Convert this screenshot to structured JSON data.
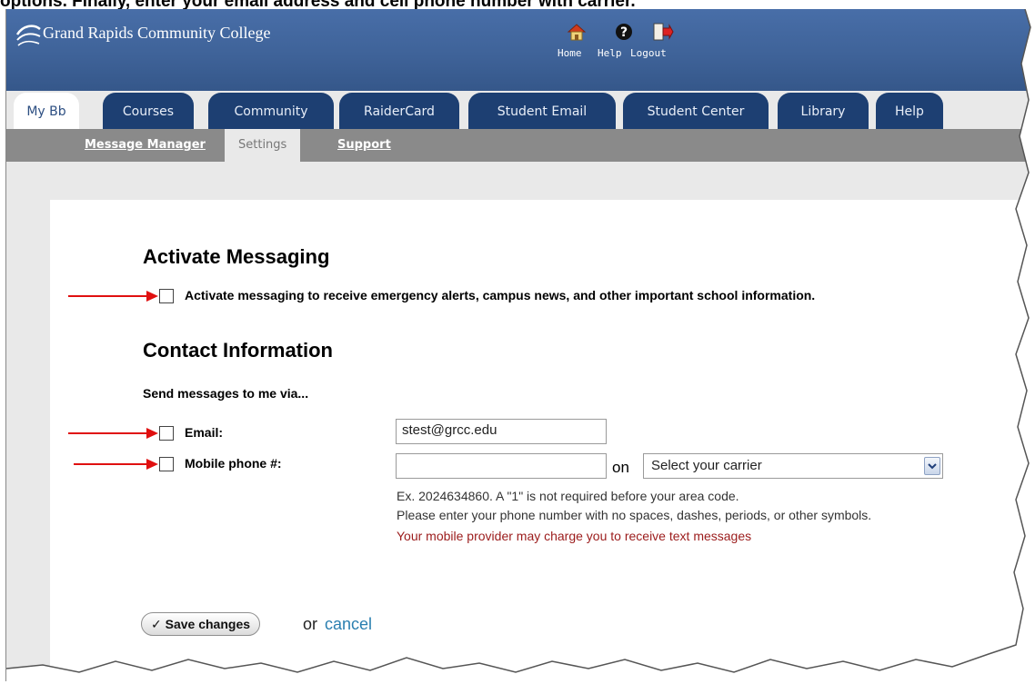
{
  "caption": "options. Finally, enter your email address and cell phone number with carrier.",
  "header": {
    "logo_text": "Grand Rapids Community College",
    "nav": [
      {
        "label": "Home",
        "icon": "home-icon"
      },
      {
        "label": "Help",
        "icon": "help-icon"
      },
      {
        "label": "Logout",
        "icon": "logout-icon"
      }
    ]
  },
  "tabs": [
    "My Bb",
    "Courses",
    "Community",
    "RaiderCard",
    "Student Email",
    "Student Center",
    "Library",
    "Help"
  ],
  "active_tab": "My Bb",
  "subnav": {
    "message_manager": "Message Manager",
    "settings": "Settings",
    "support": "Support"
  },
  "activate": {
    "heading": "Activate Messaging",
    "checkbox_label": "Activate messaging to receive emergency alerts, campus news, and other important school information."
  },
  "contact": {
    "heading": "Contact Information",
    "send_via": "Send messages to me via...",
    "email_label": "Email:",
    "email_value": "stest@grcc.edu",
    "mobile_label": "Mobile phone #:",
    "mobile_value": "",
    "on_label": "on",
    "carrier_selected": "Select your carrier",
    "help1": "Ex. 2024634860. A \"1\" is not required before your area code.",
    "help2": "Please enter your phone number with no spaces, dashes, periods, or other symbols.",
    "warning": "Your mobile provider may charge you to receive text messages"
  },
  "actions": {
    "save": "Save changes",
    "or": "or",
    "cancel": "cancel"
  },
  "colors": {
    "header": "#3f6399",
    "tab": "#1d3f72",
    "subnav": "#8a8a8a",
    "arrow": "#e01010",
    "warning": "#9b1b1b",
    "link": "#2a7fb0"
  }
}
